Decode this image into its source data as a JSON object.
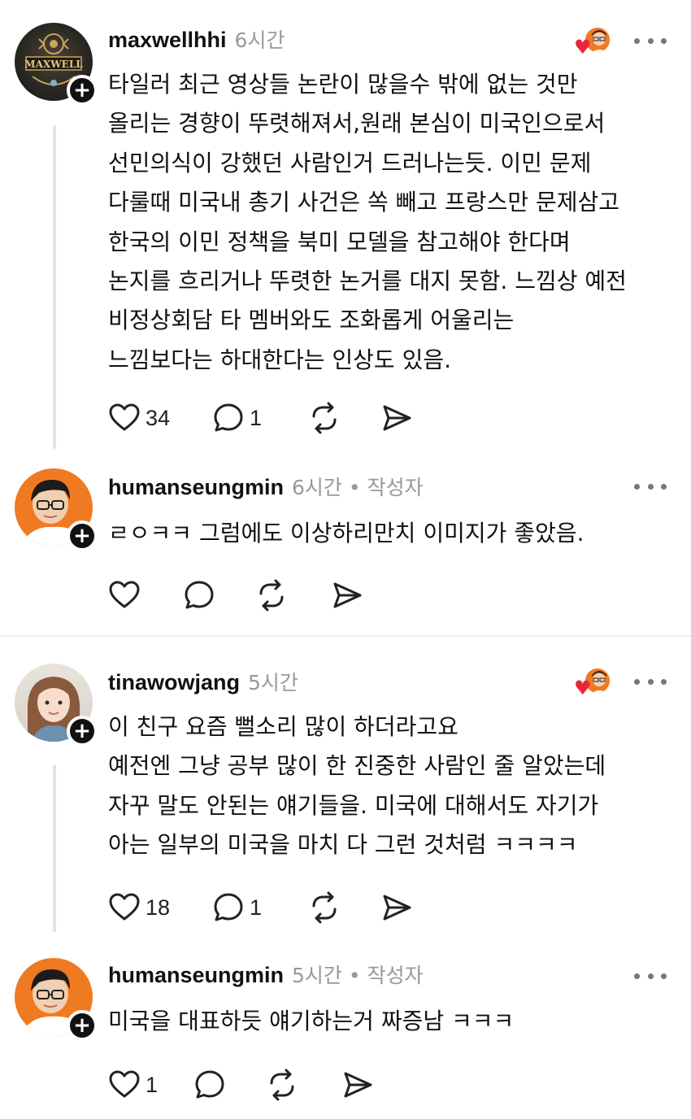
{
  "posts": [
    {
      "username": "maxwellhhi",
      "time": "6시간",
      "author_tag": "",
      "avatar_logo": "MAXWELL",
      "text": "타일러 최근 영상들 논란이 많을수 밖에 없는 것만\n올리는 경향이 뚜렷해져서,원래 본심이 미국인으로서\n선민의식이 강했던 사람인거 드러나는듯. 이민 문제\n다룰때 미국내 총기 사건은 쏙 빼고 프랑스만 문제삼고\n한국의 이민 정책을 북미 모델을 참고해야 한다며\n논지를 흐리거나 뚜렷한 논거를 대지 못함. 느낌상 예전\n비정상회담 타 멤버와도 조화롭게 어울리는\n느낌보다는 하대한다는 인상도 있음.",
      "likes": "34",
      "replies": "1"
    },
    {
      "username": "humanseungmin",
      "time": "6시간",
      "author_tag": "• 작성자",
      "text": "ㄹㅇㅋㅋ 그럼에도 이상하리만치 이미지가 좋았음.",
      "likes": "",
      "replies": ""
    },
    {
      "username": "tinawowjang",
      "time": "5시간",
      "author_tag": "",
      "text": "이 친구 요즘 뻘소리 많이 하더라고요\n예전엔 그냥 공부 많이 한 진중한 사람인 줄 알았는데\n자꾸 말도 안된는 얘기들을. 미국에 대해서도 자기가\n아는 일부의 미국을 마치 다 그런 것처럼 ㅋㅋㅋㅋ",
      "likes": "18",
      "replies": "1"
    },
    {
      "username": "humanseungmin",
      "time": "5시간",
      "author_tag": "• 작성자",
      "text": "미국을 대표하듯 얘기하는거 짜증남 ㅋㅋㅋ",
      "likes": "1",
      "replies": ""
    }
  ],
  "icons": {
    "like": "heart-outline-icon",
    "reply": "comment-bubble-icon",
    "repost": "repost-arrows-icon",
    "share": "send-arrow-icon",
    "more": "more-dots-icon",
    "follow": "plus-icon"
  },
  "colors": {
    "text": "#111111",
    "muted": "#999999",
    "heart": "#e8273a",
    "avatar_orange": "#f07a22"
  }
}
